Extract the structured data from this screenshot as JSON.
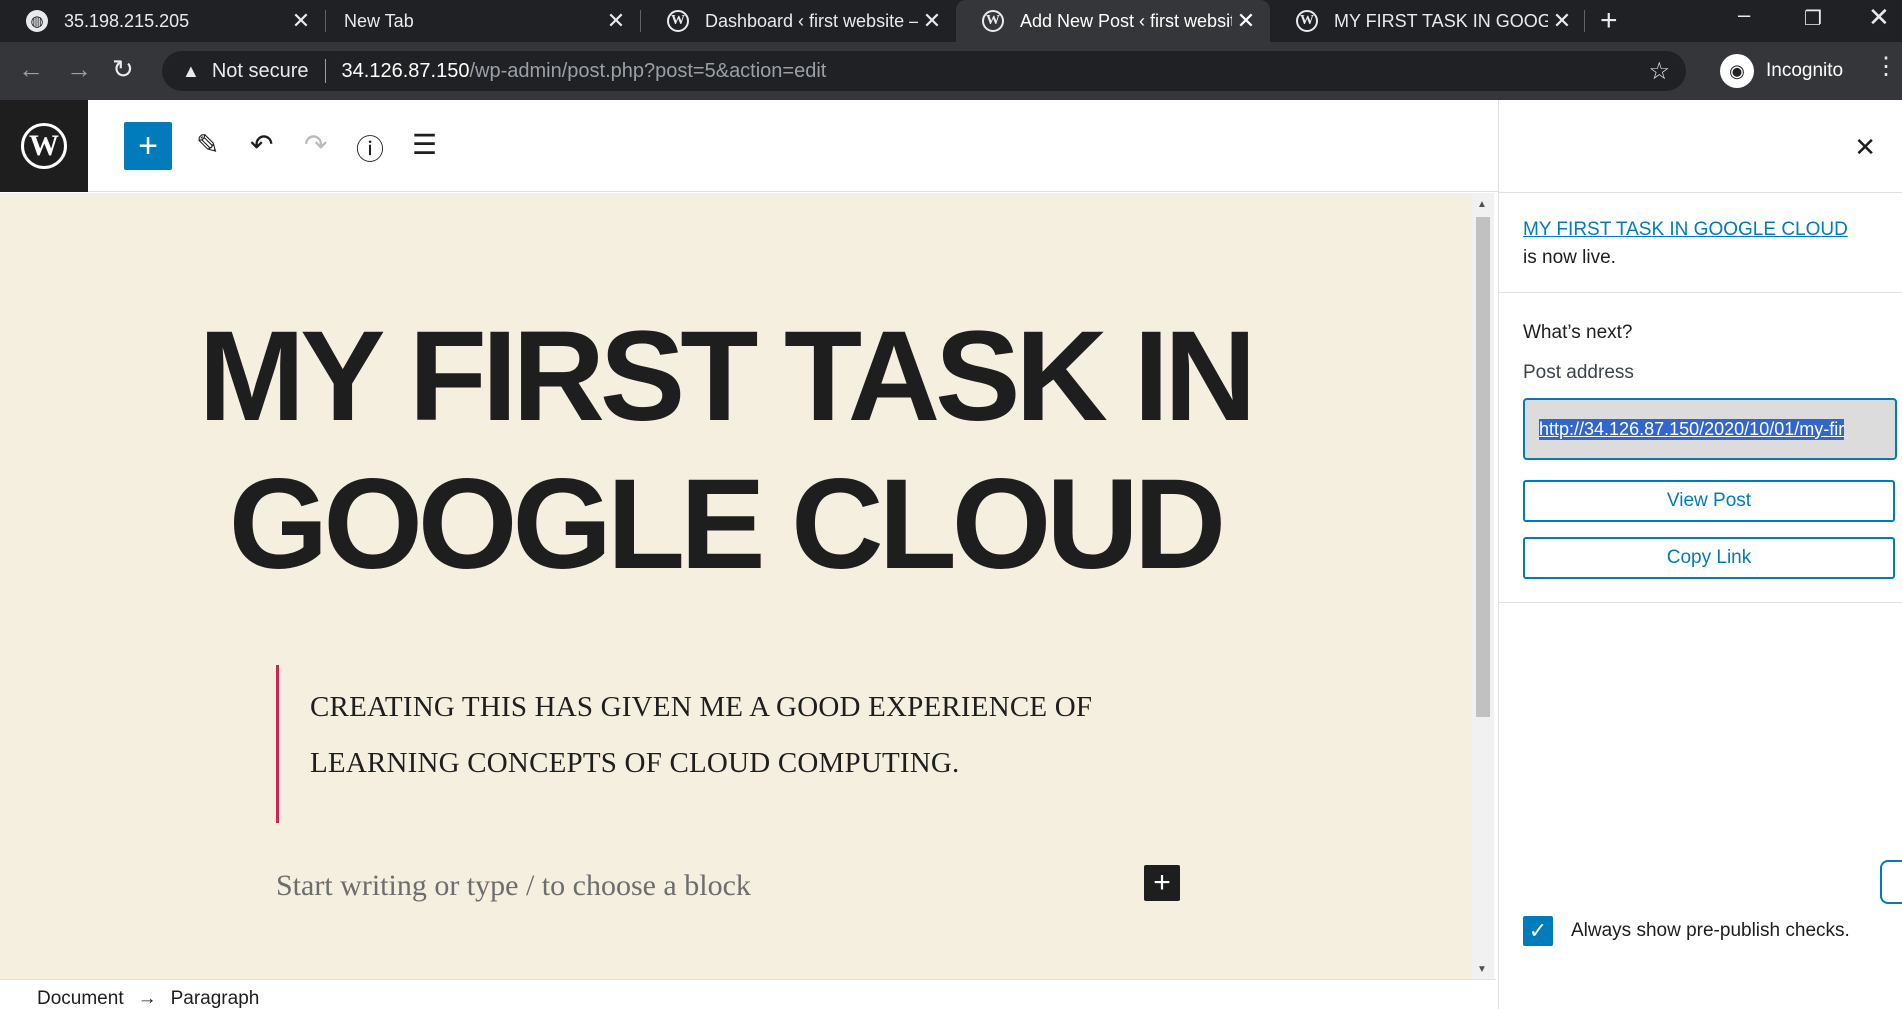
{
  "browser": {
    "tabs": [
      {
        "title": "35.198.215.205",
        "icon": "globe-icon"
      },
      {
        "title": "New Tab",
        "icon": ""
      },
      {
        "title": "Dashboard ‹ first website —",
        "icon": "wordpress-icon"
      },
      {
        "title": "Add New Post ‹ first website",
        "icon": "wordpress-icon"
      },
      {
        "title": "MY FIRST TASK IN GOOGLE",
        "icon": "wordpress-icon"
      }
    ],
    "active_tab_index": 3,
    "security_label": "Not secure",
    "url_host": "34.126.87.150",
    "url_path": "/wp-admin/post.php?post=5&action=edit",
    "profile_label": "Incognito"
  },
  "editor": {
    "post_title": "MY FIRST TASK IN GOOGLE CLOUD",
    "quote": "CREATING THIS HAS GIVEN ME A GOOD EXPERIENCE OF LEARNING CONCEPTS OF CLOUD COMPUTING.",
    "placeholder": "Start writing or type / to choose a block",
    "breadcrumb": [
      "Document",
      "→",
      "Paragraph"
    ]
  },
  "sidebar": {
    "post_link_text": "MY FIRST TASK IN GOOGLE CLOUD",
    "live_suffix": " is now live.",
    "whats_next": "What’s next?",
    "post_address_label": "Post address",
    "post_address_value": "http://34.126.87.150/2020/10/01/my-fir",
    "view_post_label": "View Post",
    "copy_link_label": "Copy Link",
    "always_show_label": "Always show pre-publish checks.",
    "always_show_checked": true
  },
  "colors": {
    "accent": "#007cba",
    "canvas_bg": "#f5efe0",
    "quote_border": "#cd2653"
  }
}
